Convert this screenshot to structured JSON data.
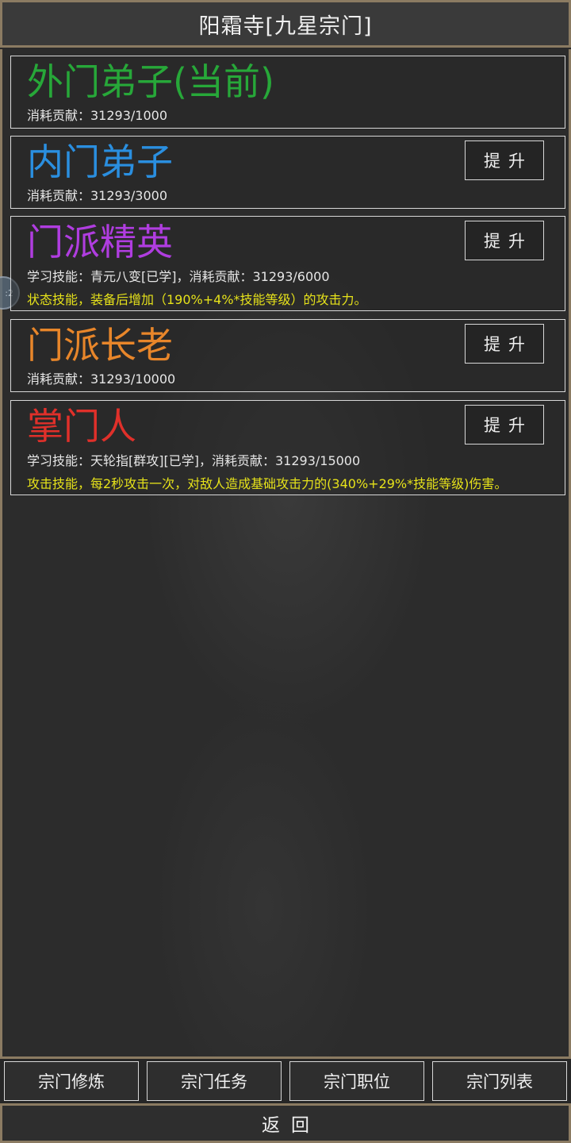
{
  "header": {
    "title": "阳霜寺[九星宗门]"
  },
  "colors": {
    "green": "#27a839",
    "blue": "#2a8fe0",
    "purple": "#b03de0",
    "orange": "#e8862a",
    "red": "#e0302a",
    "yellow": "#e6e21a",
    "gold_border": "#8b7b62"
  },
  "ranks": [
    {
      "title": "外门弟子(当前)",
      "cost": "消耗贡献：31293/1000",
      "color": "green"
    },
    {
      "title": "内门弟子",
      "cost": "消耗贡献：31293/3000",
      "color": "blue",
      "button": "提升"
    },
    {
      "title": "门派精英",
      "cost": "学习技能：青元八变[已学]，消耗贡献：31293/6000",
      "desc": "状态技能，装备后增加（190%+4%*技能等级）的攻击力。",
      "color": "purple",
      "button": "提升"
    },
    {
      "title": "门派长老",
      "cost": "消耗贡献：31293/10000",
      "color": "orange",
      "button": "提升"
    },
    {
      "title": "掌门人",
      "cost": "学习技能：天轮指[群攻][已学]，消耗贡献：31293/15000",
      "desc": "攻击技能，每2秒攻击一次，对敌人造成基础攻击力的(340%+29%*技能等级)伤害。",
      "color": "red",
      "button": "提升"
    }
  ],
  "tabs": [
    "宗门修炼",
    "宗门任务",
    "宗门职位",
    "宗门列表"
  ],
  "back_label": "返回"
}
